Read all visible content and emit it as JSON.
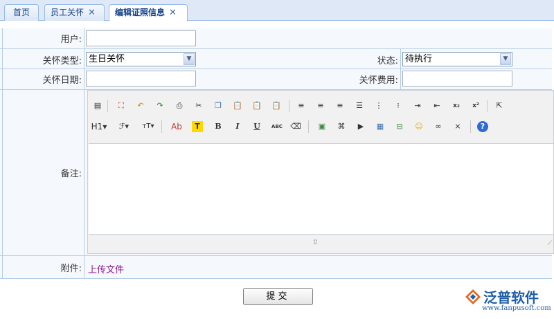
{
  "tabs": [
    {
      "label": "首页",
      "closable": false,
      "active": false
    },
    {
      "label": "员工关怀",
      "closable": true,
      "active": false
    },
    {
      "label": "编辑证照信息",
      "closable": true,
      "active": true
    }
  ],
  "close_glyph": "✕",
  "form": {
    "user_label": "用户:",
    "user_value": "",
    "care_type_label": "关怀类型:",
    "care_type_value": "生日关怀",
    "status_label": "状态:",
    "status_value": "待执行",
    "care_date_label": "关怀日期:",
    "care_date_value": "",
    "care_cost_label": "关怀费用:",
    "care_cost_value": "",
    "remarks_label": "备注:",
    "attachment_label": "附件:",
    "upload_link": "上传文件",
    "submit_label": "提交"
  },
  "editor_toolbar": {
    "heading_label": "H1",
    "text_color_label": "Ab",
    "highlight_label": "T",
    "bold_label": "B",
    "italic_label": "I",
    "underline_label": "U",
    "strike_label": "ABC",
    "sub_label": "x₂",
    "sup_label": "x²"
  },
  "brand": {
    "name": "泛普软件",
    "url": "www.fanpusoft.com"
  },
  "colors": {
    "tab_text": "#15428b",
    "border": "#b5cde6",
    "row_bg": "#f5f9fd",
    "link": "#8b1a8b",
    "brand": "#1f5ea8"
  }
}
